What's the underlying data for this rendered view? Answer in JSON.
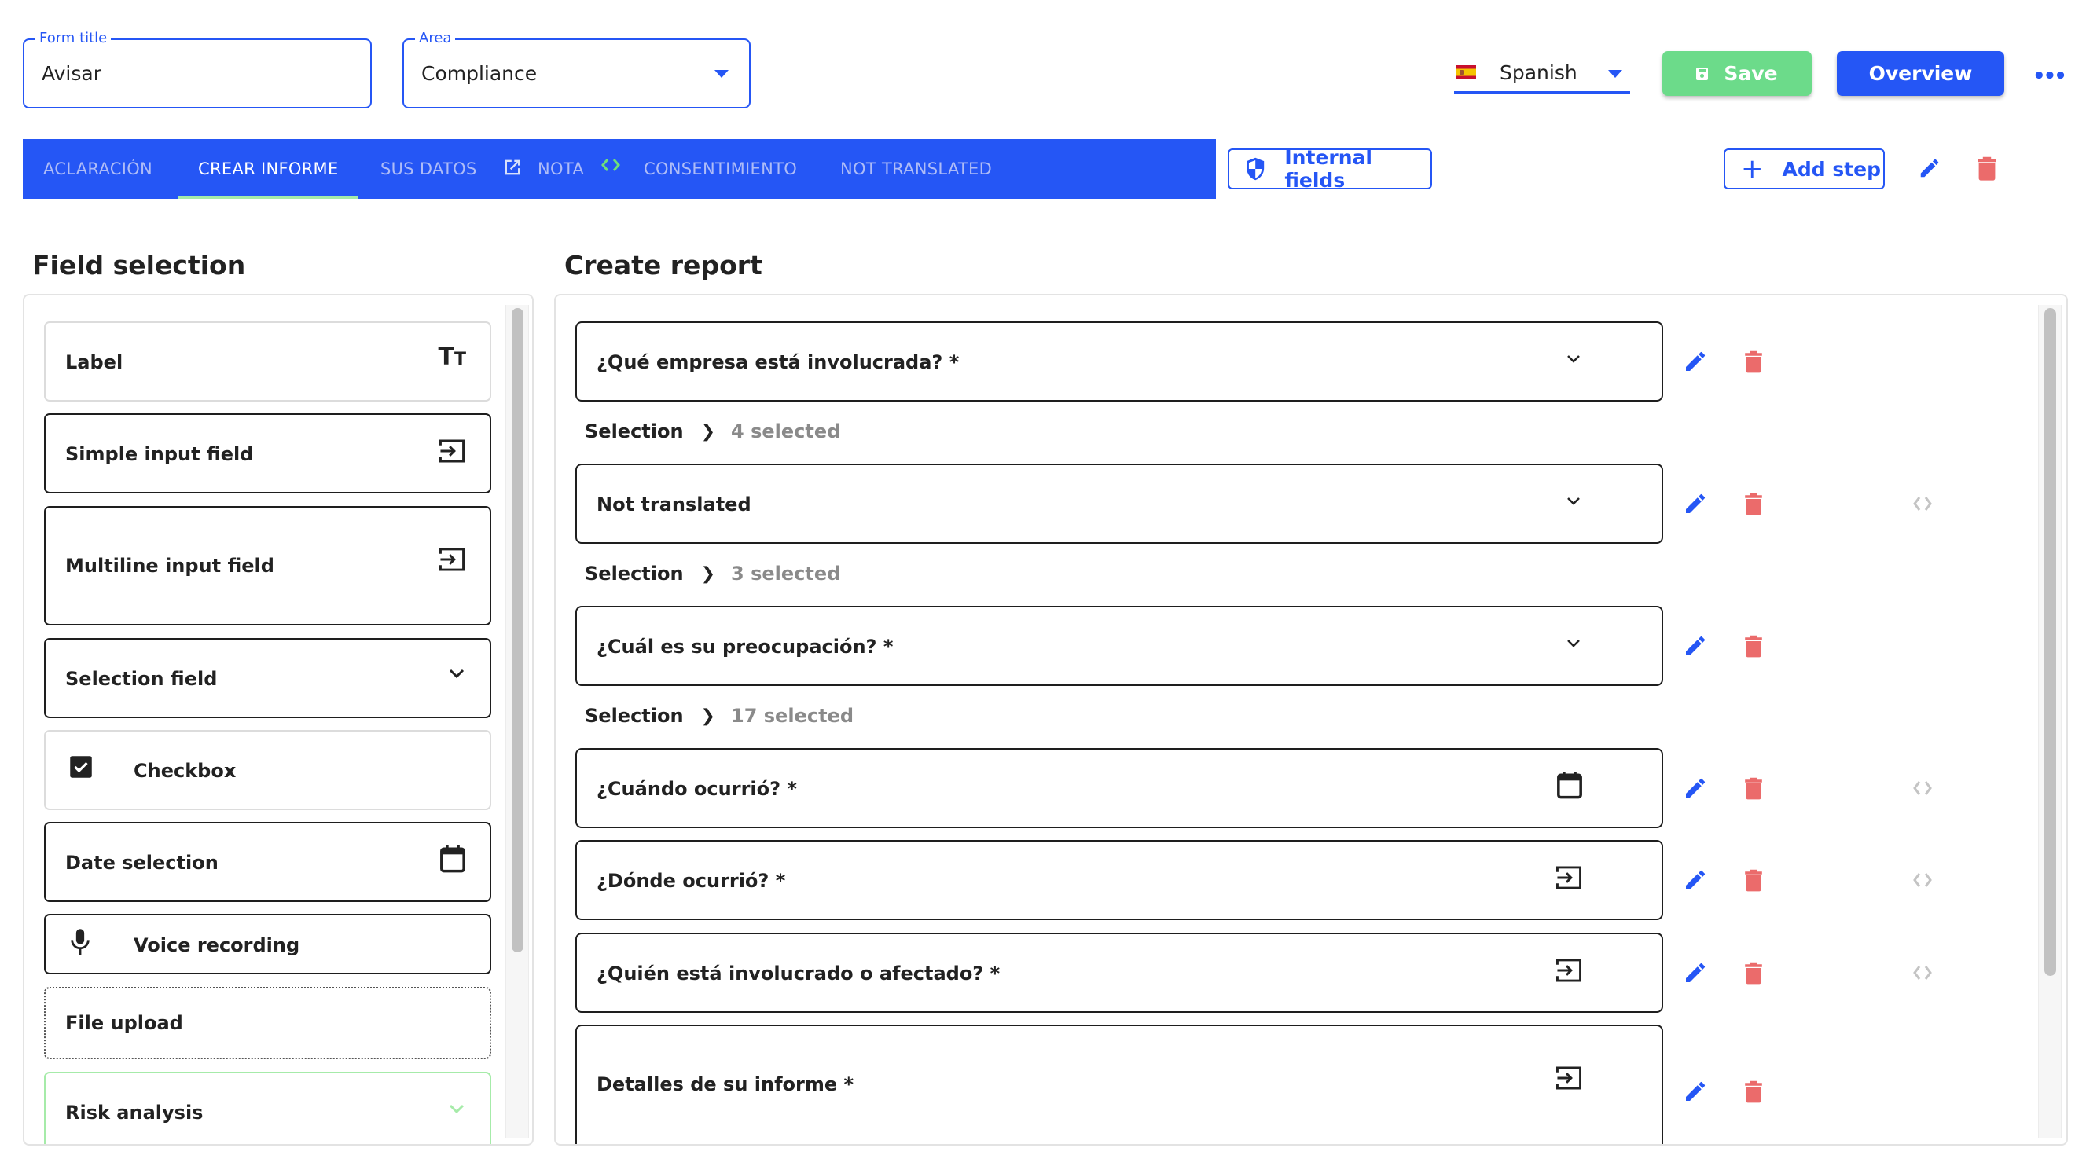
{
  "header": {
    "form_title": {
      "label": "Form title",
      "value": "Avisar"
    },
    "area": {
      "label": "Area",
      "value": "Compliance"
    },
    "language": {
      "value": "Spanish",
      "flag": "spain-flag-icon"
    },
    "save_label": "Save",
    "overview_label": "Overview",
    "more_label": "•••"
  },
  "tabs": [
    {
      "label": "ACLARACIÓN",
      "active": false
    },
    {
      "label": "CREAR INFORME",
      "active": true
    },
    {
      "label": "SUS DATOS",
      "active": false,
      "icon": "external-link-icon"
    },
    {
      "label": "NOTA",
      "active": false,
      "icon": "code-icon"
    },
    {
      "label": "CONSENTIMIENTO",
      "active": false
    },
    {
      "label": "NOT TRANSLATED",
      "active": false
    }
  ],
  "toolbar": {
    "internal_fields_label": "Internal fields",
    "add_step_label": "Add step",
    "add_step_icon": "+"
  },
  "field_selection": {
    "title": "Field selection",
    "items": [
      {
        "label": "Label",
        "icon": "text-size-icon",
        "icon_glyph": "Tт"
      },
      {
        "label": "Simple input field",
        "icon": "input-icon"
      },
      {
        "label": "Multiline input field",
        "icon": "input-icon"
      },
      {
        "label": "Selection field",
        "icon": "chevron-down-icon"
      },
      {
        "label": "Checkbox",
        "icon": "checkbox-icon"
      },
      {
        "label": "Date selection",
        "icon": "calendar-icon"
      },
      {
        "label": "Voice recording",
        "icon": "microphone-icon"
      },
      {
        "label": "File upload",
        "icon": ""
      },
      {
        "label": "Risk analysis",
        "icon": "chevron-down-icon"
      }
    ]
  },
  "create_report": {
    "title": "Create report",
    "selection_label": "Selection",
    "questions": [
      {
        "label": "¿Qué empresa está involucrada? *",
        "type": "selection",
        "selected": "4 selected",
        "code": false
      },
      {
        "label": "Not translated",
        "type": "selection",
        "selected": "3 selected",
        "code": true
      },
      {
        "label": "¿Cuál es su preocupación? *",
        "type": "selection",
        "selected": "17 selected",
        "code": false
      },
      {
        "label": "¿Cuándo ocurrió? *",
        "type": "date",
        "code": true
      },
      {
        "label": "¿Dónde ocurrió? *",
        "type": "input",
        "code": true
      },
      {
        "label": "¿Quién está involucrado o afectado? *",
        "type": "input",
        "code": true
      },
      {
        "label": "Detalles de su informe *",
        "type": "multiline",
        "code": false
      }
    ]
  },
  "colors": {
    "primary": "#2556f5",
    "save_green": "#6cdb8a",
    "delete_red": "#eb6b6b",
    "tab_inactive": "#aebcf7",
    "tab_indicator": "#a6eba9",
    "muted_text": "#8a8a8a"
  }
}
